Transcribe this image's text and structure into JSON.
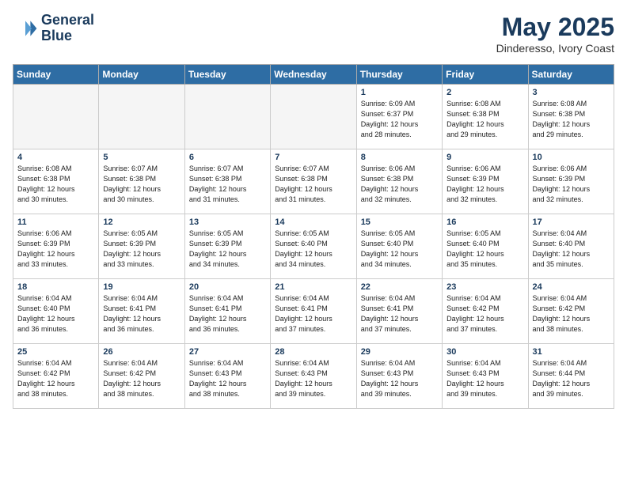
{
  "header": {
    "logo_line1": "General",
    "logo_line2": "Blue",
    "main_title": "May 2025",
    "subtitle": "Dinderesso, Ivory Coast"
  },
  "weekdays": [
    "Sunday",
    "Monday",
    "Tuesday",
    "Wednesday",
    "Thursday",
    "Friday",
    "Saturday"
  ],
  "weeks": [
    [
      {
        "day": "",
        "info": ""
      },
      {
        "day": "",
        "info": ""
      },
      {
        "day": "",
        "info": ""
      },
      {
        "day": "",
        "info": ""
      },
      {
        "day": "1",
        "info": "Sunrise: 6:09 AM\nSunset: 6:37 PM\nDaylight: 12 hours\nand 28 minutes."
      },
      {
        "day": "2",
        "info": "Sunrise: 6:08 AM\nSunset: 6:38 PM\nDaylight: 12 hours\nand 29 minutes."
      },
      {
        "day": "3",
        "info": "Sunrise: 6:08 AM\nSunset: 6:38 PM\nDaylight: 12 hours\nand 29 minutes."
      }
    ],
    [
      {
        "day": "4",
        "info": "Sunrise: 6:08 AM\nSunset: 6:38 PM\nDaylight: 12 hours\nand 30 minutes."
      },
      {
        "day": "5",
        "info": "Sunrise: 6:07 AM\nSunset: 6:38 PM\nDaylight: 12 hours\nand 30 minutes."
      },
      {
        "day": "6",
        "info": "Sunrise: 6:07 AM\nSunset: 6:38 PM\nDaylight: 12 hours\nand 31 minutes."
      },
      {
        "day": "7",
        "info": "Sunrise: 6:07 AM\nSunset: 6:38 PM\nDaylight: 12 hours\nand 31 minutes."
      },
      {
        "day": "8",
        "info": "Sunrise: 6:06 AM\nSunset: 6:38 PM\nDaylight: 12 hours\nand 32 minutes."
      },
      {
        "day": "9",
        "info": "Sunrise: 6:06 AM\nSunset: 6:39 PM\nDaylight: 12 hours\nand 32 minutes."
      },
      {
        "day": "10",
        "info": "Sunrise: 6:06 AM\nSunset: 6:39 PM\nDaylight: 12 hours\nand 32 minutes."
      }
    ],
    [
      {
        "day": "11",
        "info": "Sunrise: 6:06 AM\nSunset: 6:39 PM\nDaylight: 12 hours\nand 33 minutes."
      },
      {
        "day": "12",
        "info": "Sunrise: 6:05 AM\nSunset: 6:39 PM\nDaylight: 12 hours\nand 33 minutes."
      },
      {
        "day": "13",
        "info": "Sunrise: 6:05 AM\nSunset: 6:39 PM\nDaylight: 12 hours\nand 34 minutes."
      },
      {
        "day": "14",
        "info": "Sunrise: 6:05 AM\nSunset: 6:40 PM\nDaylight: 12 hours\nand 34 minutes."
      },
      {
        "day": "15",
        "info": "Sunrise: 6:05 AM\nSunset: 6:40 PM\nDaylight: 12 hours\nand 34 minutes."
      },
      {
        "day": "16",
        "info": "Sunrise: 6:05 AM\nSunset: 6:40 PM\nDaylight: 12 hours\nand 35 minutes."
      },
      {
        "day": "17",
        "info": "Sunrise: 6:04 AM\nSunset: 6:40 PM\nDaylight: 12 hours\nand 35 minutes."
      }
    ],
    [
      {
        "day": "18",
        "info": "Sunrise: 6:04 AM\nSunset: 6:40 PM\nDaylight: 12 hours\nand 36 minutes."
      },
      {
        "day": "19",
        "info": "Sunrise: 6:04 AM\nSunset: 6:41 PM\nDaylight: 12 hours\nand 36 minutes."
      },
      {
        "day": "20",
        "info": "Sunrise: 6:04 AM\nSunset: 6:41 PM\nDaylight: 12 hours\nand 36 minutes."
      },
      {
        "day": "21",
        "info": "Sunrise: 6:04 AM\nSunset: 6:41 PM\nDaylight: 12 hours\nand 37 minutes."
      },
      {
        "day": "22",
        "info": "Sunrise: 6:04 AM\nSunset: 6:41 PM\nDaylight: 12 hours\nand 37 minutes."
      },
      {
        "day": "23",
        "info": "Sunrise: 6:04 AM\nSunset: 6:42 PM\nDaylight: 12 hours\nand 37 minutes."
      },
      {
        "day": "24",
        "info": "Sunrise: 6:04 AM\nSunset: 6:42 PM\nDaylight: 12 hours\nand 38 minutes."
      }
    ],
    [
      {
        "day": "25",
        "info": "Sunrise: 6:04 AM\nSunset: 6:42 PM\nDaylight: 12 hours\nand 38 minutes."
      },
      {
        "day": "26",
        "info": "Sunrise: 6:04 AM\nSunset: 6:42 PM\nDaylight: 12 hours\nand 38 minutes."
      },
      {
        "day": "27",
        "info": "Sunrise: 6:04 AM\nSunset: 6:43 PM\nDaylight: 12 hours\nand 38 minutes."
      },
      {
        "day": "28",
        "info": "Sunrise: 6:04 AM\nSunset: 6:43 PM\nDaylight: 12 hours\nand 39 minutes."
      },
      {
        "day": "29",
        "info": "Sunrise: 6:04 AM\nSunset: 6:43 PM\nDaylight: 12 hours\nand 39 minutes."
      },
      {
        "day": "30",
        "info": "Sunrise: 6:04 AM\nSunset: 6:43 PM\nDaylight: 12 hours\nand 39 minutes."
      },
      {
        "day": "31",
        "info": "Sunrise: 6:04 AM\nSunset: 6:44 PM\nDaylight: 12 hours\nand 39 minutes."
      }
    ]
  ]
}
